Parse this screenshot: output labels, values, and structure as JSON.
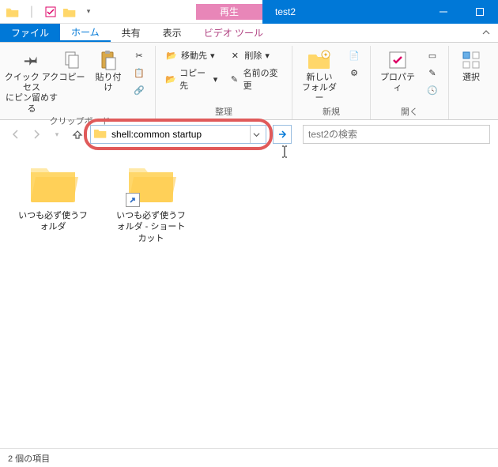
{
  "titlebar": {
    "contextual_label": "再生",
    "title": "test2"
  },
  "tabs": {
    "file": "ファイル",
    "home": "ホーム",
    "share": "共有",
    "view": "表示",
    "video_tools": "ビデオ ツール"
  },
  "ribbon": {
    "clipboard": {
      "pin": "クイック アクセス\nにピン留めする",
      "copy": "コピー",
      "paste": "貼り付け",
      "label": "クリップボード"
    },
    "organize": {
      "move_to": "移動先",
      "copy_to": "コピー先",
      "delete": "削除",
      "rename": "名前の変更",
      "label": "整理"
    },
    "new": {
      "new_folder": "新しい\nフォルダー",
      "label": "新規"
    },
    "open": {
      "properties": "プロパティ",
      "label": "開く"
    },
    "select": {
      "select": "選択",
      "label": ""
    }
  },
  "address": {
    "value": "shell:common startup"
  },
  "search": {
    "placeholder": "test2の検索"
  },
  "items": [
    {
      "name": "いつも必ず使うフォルダ",
      "shortcut": false
    },
    {
      "name": "いつも必ず使うフォルダ - ショートカット",
      "shortcut": true
    }
  ],
  "status": {
    "count": "2 個の項目"
  }
}
